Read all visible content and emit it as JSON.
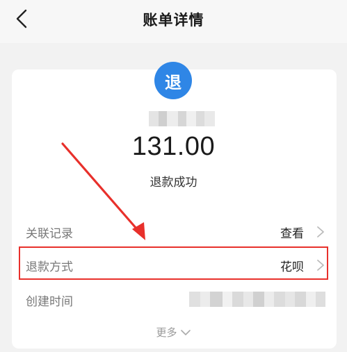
{
  "header": {
    "title": "账单详情",
    "back_icon": "chevron-left-icon"
  },
  "transaction": {
    "badge_label": "退",
    "badge_color": "#2f86e6",
    "amount": "131.00",
    "status": "退款成功"
  },
  "details": {
    "rows": [
      {
        "label": "关联记录",
        "value": "查看",
        "icon": "chevron-right-icon"
      },
      {
        "label": "退款方式",
        "value": "花呗",
        "icon": "chevron-right-icon"
      },
      {
        "label": "创建时间",
        "value": ""
      }
    ],
    "more_label": "更多",
    "more_icon": "chevron-down-icon"
  },
  "annotation": {
    "color": "#e8302b"
  }
}
